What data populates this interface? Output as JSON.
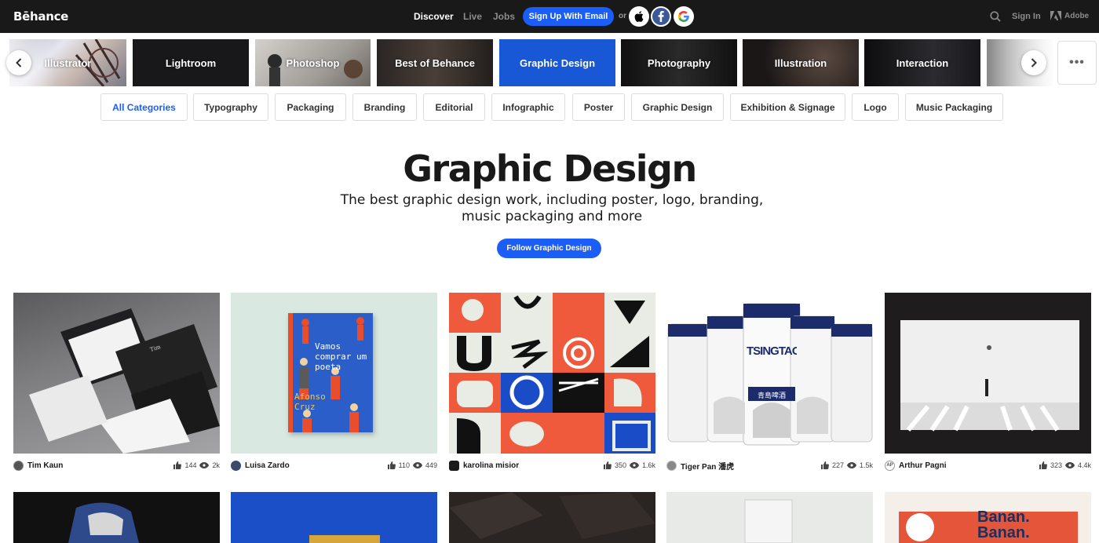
{
  "header": {
    "logo": "Bēhance",
    "nav": [
      "Discover",
      "Live",
      "Jobs"
    ],
    "signup_label": "Sign Up With Email",
    "or_label": "or",
    "signin_label": "Sign In",
    "adobe_label": "Adobe"
  },
  "carousel": {
    "tiles": [
      "Illustrator",
      "Lightroom",
      "Photoshop",
      "Best of Behance",
      "Graphic Design",
      "Photography",
      "Illustration",
      "Interaction"
    ],
    "active": "Graphic Design",
    "more_label": "•••"
  },
  "subcategories": {
    "items": [
      "All Categories",
      "Typography",
      "Packaging",
      "Branding",
      "Editorial",
      "Infographic",
      "Poster",
      "Graphic Design",
      "Exhibition & Signage",
      "Logo",
      "Music Packaging"
    ],
    "active": "All Categories"
  },
  "hero": {
    "title": "Graphic Design",
    "subtitle_line1": "The best graphic design work, including poster, logo, branding,",
    "subtitle_line2": "music packaging and more",
    "follow_label": "Follow Graphic Design"
  },
  "projects": [
    {
      "owner": "Tim Kaun",
      "likes": "144",
      "views": "2k"
    },
    {
      "owner": "Luisa Zardo",
      "likes": "110",
      "views": "449",
      "cover_title": "Vamos comprar um poeta",
      "cover_author": "Afonso Cruz"
    },
    {
      "owner": "karolina misior",
      "likes": "350",
      "views": "1.6k"
    },
    {
      "owner": "Tiger Pan 潘虎",
      "likes": "227",
      "views": "1.5k",
      "can_text": "TSINGTAO",
      "can_cn": "青島啤酒"
    },
    {
      "owner": "Arthur Pagni",
      "likes": "323",
      "views": "4.4k",
      "avatar_text": "AP"
    }
  ],
  "row2": {
    "banana_text": [
      "Banan.",
      "Banan."
    ]
  },
  "colors": {
    "accent": "#1b5ef7",
    "nav_bg": "#191919",
    "active_tile": "#1857d6"
  }
}
